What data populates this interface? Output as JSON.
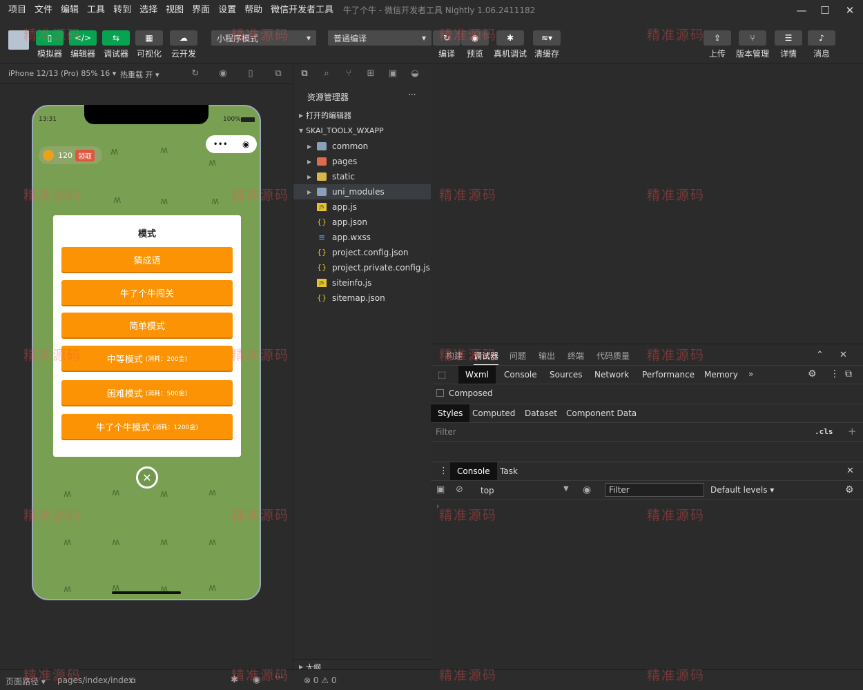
{
  "menu": {
    "items": [
      "项目",
      "文件",
      "编辑",
      "工具",
      "转到",
      "选择",
      "视图",
      "界面",
      "设置",
      "帮助",
      "微信开发者工具"
    ],
    "window_title": "牛了个牛 - 微信开发者工具 Nightly 1.06.2411182"
  },
  "toolbar": {
    "simulator": "模拟器",
    "editor": "编辑器",
    "debugger": "调试器",
    "visual": "可视化",
    "cloud": "云开发",
    "mode_select": "小程序模式",
    "compile_select": "普通编译",
    "compile": "编译",
    "preview": "预览",
    "remote_debug": "真机调试",
    "clear_cache": "清缓存",
    "upload": "上传",
    "version": "版本管理",
    "details": "详情",
    "messages": "消息"
  },
  "sim": {
    "device": "iPhone 12/13 (Pro) 85% 16 ▾",
    "hot_reload": "热重载 开 ▾",
    "time": "13:31",
    "battery": "100%",
    "coins": "120",
    "claim": "领取"
  },
  "modal": {
    "title": "模式",
    "buttons": [
      {
        "label": "猜成语",
        "cost": ""
      },
      {
        "label": "牛了个牛闯关",
        "cost": ""
      },
      {
        "label": "简单模式",
        "cost": ""
      },
      {
        "label": "中等模式",
        "cost": "(消耗：200金)"
      },
      {
        "label": "困难模式",
        "cost": "(消耗：500金)"
      },
      {
        "label": "牛了个牛模式",
        "cost": "(消耗：1200金)"
      }
    ]
  },
  "explorer": {
    "title": "资源管理器",
    "more": "···",
    "open_editors": "打开的编辑器",
    "project": "SKAI_TOOLX_WXAPP",
    "folders": [
      "common",
      "pages",
      "static",
      "uni_modules"
    ],
    "files": [
      "app.js",
      "app.json",
      "app.wxss",
      "project.config.json",
      "project.private.config.js...",
      "siteinfo.js",
      "sitemap.json"
    ],
    "outline": "大纲"
  },
  "debugger": {
    "top_tabs": [
      "构建",
      "调试器",
      "问题",
      "输出",
      "终端",
      "代码质量"
    ],
    "dev_tabs": [
      "Wxml",
      "Console",
      "Sources",
      "Network",
      "Performance",
      "Memory"
    ],
    "composed": "Composed",
    "style_tabs": [
      "Styles",
      "Computed",
      "Dataset",
      "Component Data"
    ],
    "filter_placeholder": "Filter",
    "cls": ".cls",
    "drawer_tabs": [
      "Console",
      "Task"
    ],
    "context": "top",
    "console_filter": "Filter",
    "levels": "Default levels ▾"
  },
  "statusbar": {
    "page_path_label": "页面路径 ▾",
    "page_path": "pages/index/index",
    "errors": "⊗ 0 ⚠ 0"
  },
  "watermark": "精准源码"
}
